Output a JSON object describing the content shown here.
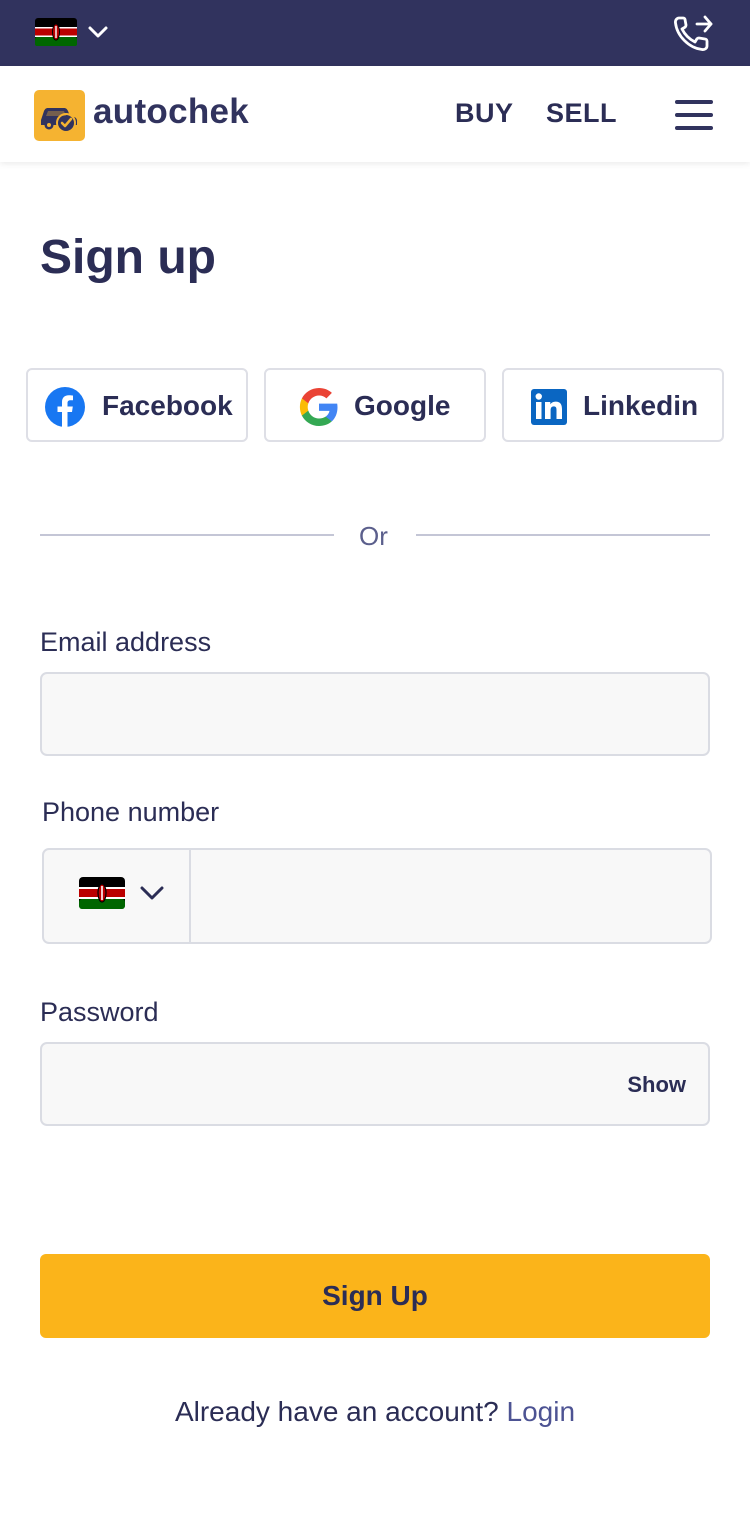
{
  "colors": {
    "topbar_bg": "#31335e",
    "brand_yellow": "#fbb41a",
    "text_primary": "#2b2d55",
    "link": "#4d5393",
    "input_bg": "#f8f8f8"
  },
  "topbar": {
    "country_flag_icon": "kenya-flag-icon",
    "country_dropdown_icon": "chevron-down-icon",
    "call_icon": "phone-forward-icon"
  },
  "navbar": {
    "logo_text": "autochek",
    "buy_label": "BUY",
    "sell_label": "SELL",
    "menu_icon": "hamburger-menu-icon"
  },
  "page": {
    "title": "Sign up"
  },
  "social": [
    {
      "label": "Facebook",
      "icon": "facebook-icon"
    },
    {
      "label": "Google",
      "icon": "google-icon"
    },
    {
      "label": "Linkedin",
      "icon": "linkedin-icon"
    }
  ],
  "divider": {
    "text": "Or"
  },
  "form": {
    "email": {
      "label": "Email address",
      "value": "",
      "placeholder": ""
    },
    "phone": {
      "label": "Phone number",
      "value": "",
      "placeholder": "",
      "country_flag_icon": "kenya-flag-icon"
    },
    "password": {
      "label": "Password",
      "value": "",
      "placeholder": "",
      "toggle_label": "Show"
    },
    "submit_label": "Sign Up"
  },
  "footer": {
    "prompt": "Already have an account? ",
    "login_link": "Login"
  }
}
